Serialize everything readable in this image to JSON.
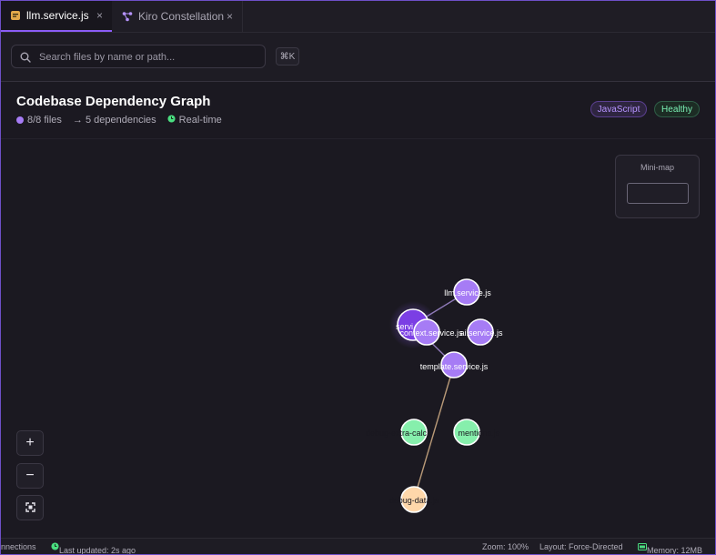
{
  "tabs": [
    {
      "label": "llm.service.js",
      "icon": "js-file-icon",
      "close": "×",
      "active": true
    },
    {
      "label": "Kiro Constellation",
      "icon": "constellation-icon",
      "close": "×",
      "active": false
    }
  ],
  "search": {
    "placeholder": "Search files by name or path...",
    "value": "",
    "shortcut": "⌘K"
  },
  "header": {
    "title": "Codebase Dependency Graph",
    "files": "8/8 files",
    "dependencies": "→ 5 dependencies",
    "realtime": "Real-time",
    "badges": {
      "language": "JavaScript",
      "health": "Healthy"
    }
  },
  "minimap": {
    "label": "Mini-map"
  },
  "controls": {
    "zoom_in": "+",
    "zoom_out": "−",
    "fit": "⤢"
  },
  "graph": {
    "colors": {
      "service": "#a67cf5",
      "hub": "#7b3fe4",
      "debug": "#86efac",
      "data": "#fed7aa",
      "edge": "#8f7ab8"
    },
    "nodes": [
      {
        "id": "llm",
        "label": "llm.service.js",
        "type": "service"
      },
      {
        "id": "hub",
        "label": "servi",
        "type": "hub"
      },
      {
        "id": "context",
        "label": "context.service.js",
        "type": "service"
      },
      {
        "id": "ai",
        "label": "ai.service.js",
        "type": "service"
      },
      {
        "id": "template",
        "label": "template.service.js",
        "type": "service"
      },
      {
        "id": "debug_extra",
        "label": "debug-extra-calc",
        "type": "debug"
      },
      {
        "id": "debug_mentions",
        "label": "mentions.js",
        "type": "debug"
      },
      {
        "id": "debug_data",
        "label": "debug-data.js",
        "type": "data"
      }
    ]
  },
  "status": {
    "connections": "nnections",
    "updated": "Last updated: 2s ago",
    "zoom": "Zoom: 100%",
    "layout": "Layout: Force-Directed",
    "memory": "Memory: 12MB"
  },
  "accent": "#8b5cf6",
  "healthy_color": "#4ade80"
}
